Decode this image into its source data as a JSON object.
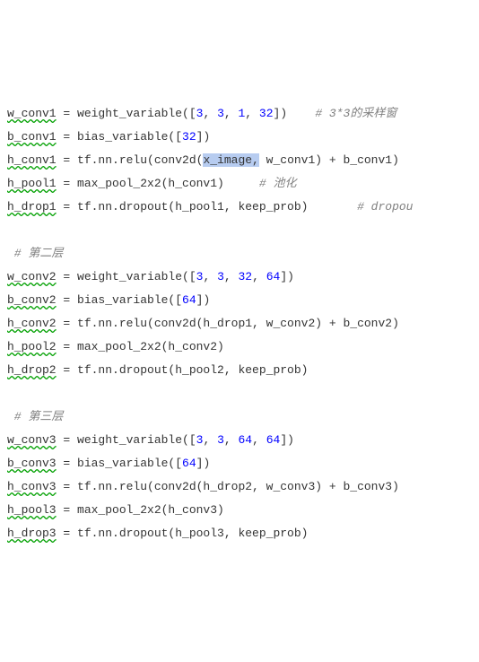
{
  "lines": [
    {
      "tokens": [
        {
          "t": "w_conv1 = weight_variable(["
        },
        {
          "t": "3",
          "c": "num"
        },
        {
          "t": ", "
        },
        {
          "t": "3",
          "c": "num"
        },
        {
          "t": ", "
        },
        {
          "t": "1",
          "c": "num"
        },
        {
          "t": ", "
        },
        {
          "t": "32",
          "c": "num"
        },
        {
          "t": "])    "
        },
        {
          "t": "# 3*3的采样窗",
          "c": "cmt"
        }
      ]
    },
    {
      "tokens": [
        {
          "t": "b_conv1 = bias_variable(["
        },
        {
          "t": "32",
          "c": "num"
        },
        {
          "t": "])"
        }
      ]
    },
    {
      "tokens": [
        {
          "t": "h_conv1 = tf.nn.relu(conv2d("
        },
        {
          "t": "x_image",
          "c": "sel"
        },
        {
          "t": ",",
          "c": "sel"
        },
        {
          "t": " w_conv1) + b_conv1)"
        }
      ]
    },
    {
      "tokens": [
        {
          "t": "h_pool1 = max_pool_2x2(h_conv1)     "
        },
        {
          "t": "# 池化",
          "c": "cmt"
        }
      ]
    },
    {
      "tokens": [
        {
          "t": "h_drop1 = tf.nn.dropout(h_pool1, keep_prob)       "
        },
        {
          "t": "# dropou",
          "c": "cmt"
        }
      ]
    },
    {
      "tokens": [
        {
          "t": " "
        }
      ]
    },
    {
      "tokens": [
        {
          "t": " # 第二层",
          "c": "cmt"
        }
      ]
    },
    {
      "tokens": [
        {
          "t": "w_conv2 = weight_variable(["
        },
        {
          "t": "3",
          "c": "num"
        },
        {
          "t": ", "
        },
        {
          "t": "3",
          "c": "num"
        },
        {
          "t": ", "
        },
        {
          "t": "32",
          "c": "num"
        },
        {
          "t": ", "
        },
        {
          "t": "64",
          "c": "num"
        },
        {
          "t": "])"
        }
      ]
    },
    {
      "tokens": [
        {
          "t": "b_conv2 = bias_variable(["
        },
        {
          "t": "64",
          "c": "num"
        },
        {
          "t": "])"
        }
      ]
    },
    {
      "tokens": [
        {
          "t": "h_conv2 = tf.nn.relu(conv2d(h_drop1, w_conv2) + b_conv2)"
        }
      ]
    },
    {
      "tokens": [
        {
          "t": "h_pool2 = max_pool_2x2(h_conv2)"
        }
      ]
    },
    {
      "tokens": [
        {
          "t": "h_drop2 = tf.nn.dropout(h_pool2, keep_prob)"
        }
      ]
    },
    {
      "tokens": [
        {
          "t": " "
        }
      ]
    },
    {
      "tokens": [
        {
          "t": " # 第三层",
          "c": "cmt"
        }
      ]
    },
    {
      "tokens": [
        {
          "t": "w_conv3 = weight_variable(["
        },
        {
          "t": "3",
          "c": "num"
        },
        {
          "t": ", "
        },
        {
          "t": "3",
          "c": "num"
        },
        {
          "t": ", "
        },
        {
          "t": "64",
          "c": "num"
        },
        {
          "t": ", "
        },
        {
          "t": "64",
          "c": "num"
        },
        {
          "t": "])"
        }
      ]
    },
    {
      "tokens": [
        {
          "t": "b_conv3 = bias_variable(["
        },
        {
          "t": "64",
          "c": "num"
        },
        {
          "t": "])"
        }
      ]
    },
    {
      "tokens": [
        {
          "t": "h_conv3 = tf.nn.relu(conv2d(h_drop2, w_conv3) + b_conv3)"
        }
      ]
    },
    {
      "tokens": [
        {
          "t": "h_pool3 = max_pool_2x2(h_conv3)"
        }
      ]
    },
    {
      "tokens": [
        {
          "t": "h_drop3 = tf.nn.dropout(h_pool3, keep_prob)"
        }
      ]
    }
  ],
  "squiggle_identifiers": [
    "w_conv1",
    "b_conv1",
    "h_conv1",
    "h_pool1",
    "h_drop1",
    "w_conv2",
    "b_conv2",
    "h_conv2",
    "h_pool2",
    "h_drop2",
    "w_conv3",
    "b_conv3",
    "h_conv3",
    "h_pool3",
    "h_drop3"
  ]
}
